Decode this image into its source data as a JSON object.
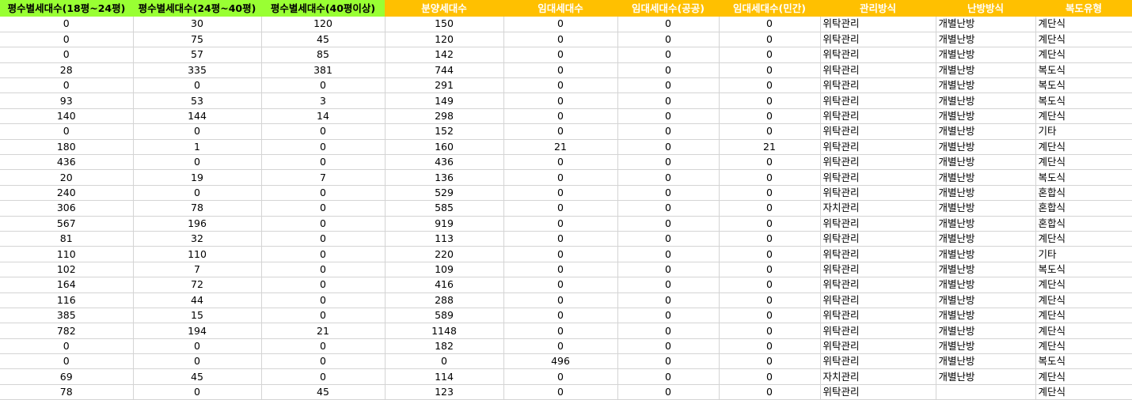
{
  "header": {
    "colors": {
      "green": "#99ff33",
      "orange": "#ffc000"
    },
    "columns": [
      "평수별세대수(18평~24평)",
      "평수별세대수(24평~40평)",
      "평수별세대수(40평이상)",
      "분양세대수",
      "임대세대수",
      "임대세대수(공공)",
      "임대세대수(민간)",
      "관리방식",
      "난방방식",
      "복도유형"
    ]
  },
  "rows": [
    [
      "0",
      "30",
      "120",
      "150",
      "0",
      "0",
      "0",
      "위탁관리",
      "개별난방",
      "계단식"
    ],
    [
      "0",
      "75",
      "45",
      "120",
      "0",
      "0",
      "0",
      "위탁관리",
      "개별난방",
      "계단식"
    ],
    [
      "0",
      "57",
      "85",
      "142",
      "0",
      "0",
      "0",
      "위탁관리",
      "개별난방",
      "계단식"
    ],
    [
      "28",
      "335",
      "381",
      "744",
      "0",
      "0",
      "0",
      "위탁관리",
      "개별난방",
      "복도식"
    ],
    [
      "0",
      "0",
      "0",
      "291",
      "0",
      "0",
      "0",
      "위탁관리",
      "개별난방",
      "복도식"
    ],
    [
      "93",
      "53",
      "3",
      "149",
      "0",
      "0",
      "0",
      "위탁관리",
      "개별난방",
      "복도식"
    ],
    [
      "140",
      "144",
      "14",
      "298",
      "0",
      "0",
      "0",
      "위탁관리",
      "개별난방",
      "계단식"
    ],
    [
      "0",
      "0",
      "0",
      "152",
      "0",
      "0",
      "0",
      "위탁관리",
      "개별난방",
      "기타"
    ],
    [
      "180",
      "1",
      "0",
      "160",
      "21",
      "0",
      "21",
      "위탁관리",
      "개별난방",
      "계단식"
    ],
    [
      "436",
      "0",
      "0",
      "436",
      "0",
      "0",
      "0",
      "위탁관리",
      "개별난방",
      "계단식"
    ],
    [
      "20",
      "19",
      "7",
      "136",
      "0",
      "0",
      "0",
      "위탁관리",
      "개별난방",
      "복도식"
    ],
    [
      "240",
      "0",
      "0",
      "529",
      "0",
      "0",
      "0",
      "위탁관리",
      "개별난방",
      "혼합식"
    ],
    [
      "306",
      "78",
      "0",
      "585",
      "0",
      "0",
      "0",
      "자치관리",
      "개별난방",
      "혼합식"
    ],
    [
      "567",
      "196",
      "0",
      "919",
      "0",
      "0",
      "0",
      "위탁관리",
      "개별난방",
      "혼합식"
    ],
    [
      "81",
      "32",
      "0",
      "113",
      "0",
      "0",
      "0",
      "위탁관리",
      "개별난방",
      "계단식"
    ],
    [
      "110",
      "110",
      "0",
      "220",
      "0",
      "0",
      "0",
      "위탁관리",
      "개별난방",
      "기타"
    ],
    [
      "102",
      "7",
      "0",
      "109",
      "0",
      "0",
      "0",
      "위탁관리",
      "개별난방",
      "복도식"
    ],
    [
      "164",
      "72",
      "0",
      "416",
      "0",
      "0",
      "0",
      "위탁관리",
      "개별난방",
      "계단식"
    ],
    [
      "116",
      "44",
      "0",
      "288",
      "0",
      "0",
      "0",
      "위탁관리",
      "개별난방",
      "계단식"
    ],
    [
      "385",
      "15",
      "0",
      "589",
      "0",
      "0",
      "0",
      "위탁관리",
      "개별난방",
      "계단식"
    ],
    [
      "782",
      "194",
      "21",
      "1148",
      "0",
      "0",
      "0",
      "위탁관리",
      "개별난방",
      "계단식"
    ],
    [
      "0",
      "0",
      "0",
      "182",
      "0",
      "0",
      "0",
      "위탁관리",
      "개별난방",
      "계단식"
    ],
    [
      "0",
      "0",
      "0",
      "0",
      "496",
      "0",
      "0",
      "위탁관리",
      "개별난방",
      "복도식"
    ],
    [
      "69",
      "45",
      "0",
      "114",
      "0",
      "0",
      "0",
      "자치관리",
      "개별난방",
      "계단식"
    ],
    [
      "78",
      "0",
      "45",
      "123",
      "0",
      "0",
      "0",
      "위탁관리",
      "",
      "계단식"
    ]
  ]
}
